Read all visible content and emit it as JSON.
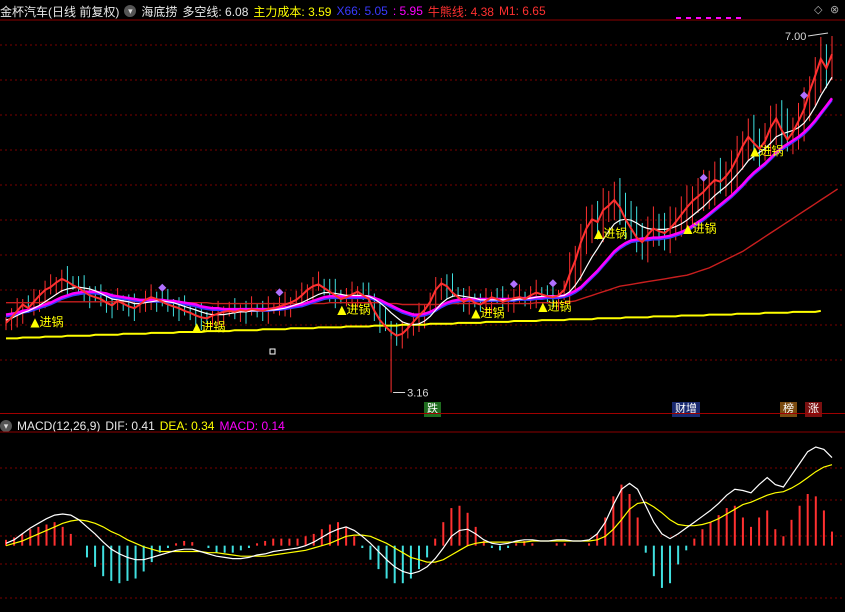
{
  "header": {
    "stock_name": "金杯汽车",
    "period_label": "(日线 前复权)",
    "indicator_name": "海底捞",
    "items": [
      {
        "label": "多空线:",
        "value": "6.08",
        "color": "#ffffff"
      },
      {
        "label": "主力成本:",
        "value": "3.59",
        "color": "#ffff00"
      },
      {
        "label": "X66:",
        "value": "5.05",
        "color": "#3a3aff"
      },
      {
        "label": ":",
        "value": "5.95",
        "color": "#ff00ff"
      },
      {
        "label": "牛熊线:",
        "value": "4.38",
        "color": "#ff3030"
      },
      {
        "label": "M1:",
        "value": "6.65",
        "color": "#ff3030"
      }
    ]
  },
  "macd_header": {
    "name": "MACD(12,26,9)",
    "dif_label": "DIF:",
    "dif_value": "0.41",
    "dea_label": "DEA:",
    "dea_value": "0.34",
    "macd_label": "MACD:",
    "macd_value": "0.14"
  },
  "window_buttons": {
    "up": "◇",
    "close": "⊗"
  },
  "badges": [
    {
      "text": "跌",
      "bg": "#1e6b1e",
      "color": "#ffffff"
    },
    {
      "text": "财增",
      "bg": "#1a2a70",
      "color": "#ffffff"
    },
    {
      "text": "榜",
      "bg": "#7a4a10",
      "color": "#ffffff"
    },
    {
      "text": "涨",
      "bg": "#7a1010",
      "color": "#ffffff"
    }
  ],
  "chart_data": {
    "type": "line",
    "annotations": {
      "high_label": "7.00",
      "low_label": "3.16",
      "signal_text": "▲进锅"
    },
    "colors": {
      "up": "#ff3030",
      "down": "#40e0e0",
      "multi_line": "#ffffff",
      "x66": "#3a3aff",
      "pink": "#ff00ff",
      "bull_bear": "#c81e1e",
      "cost": "#ffff00",
      "signal": "#ffff00",
      "diamond": "#b070ff",
      "dif": "#ffffff",
      "dea": "#ffff00"
    },
    "price_close": [
      3.92,
      3.98,
      4.05,
      4.12,
      4.08,
      4.15,
      4.22,
      4.28,
      4.31,
      4.36,
      4.4,
      4.37,
      4.33,
      4.3,
      4.26,
      4.22,
      4.2,
      4.18,
      4.14,
      4.11,
      4.16,
      4.13,
      4.1,
      4.08,
      4.12,
      4.17,
      4.2,
      4.18,
      4.15,
      4.12,
      4.1,
      4.08,
      4.05,
      4.03,
      4.0,
      3.98,
      3.97,
      4.0,
      4.02,
      4.04,
      4.05,
      4.04,
      4.06,
      4.05,
      4.07,
      4.06,
      4.05,
      4.07,
      4.08,
      4.1,
      4.12,
      4.14,
      4.17,
      4.22,
      4.28,
      4.32,
      4.34,
      4.3,
      4.26,
      4.22,
      4.18,
      4.2,
      4.23,
      4.26,
      4.22,
      4.18,
      4.05,
      3.95,
      3.88,
      3.82,
      3.78,
      3.8,
      3.86,
      3.93,
      4.0,
      4.06,
      4.15,
      4.28,
      4.35,
      4.32,
      4.25,
      4.2,
      4.15,
      4.18,
      4.14,
      4.12,
      4.16,
      4.2,
      4.18,
      4.15,
      4.17,
      4.19,
      4.2,
      4.18,
      4.22,
      4.25,
      4.23,
      4.21,
      4.2,
      4.22,
      4.28,
      4.45,
      4.6,
      4.8,
      4.95,
      5.05,
      5.02,
      5.15,
      5.2,
      5.26,
      5.18,
      5.05,
      4.95,
      4.85,
      4.8,
      4.88,
      4.95,
      4.92,
      4.9,
      4.95,
      5.02,
      5.1,
      5.18,
      5.25,
      5.3,
      5.35,
      5.42,
      5.48,
      5.46,
      5.52,
      5.6,
      5.72,
      5.85,
      5.95,
      5.88,
      5.82,
      5.9,
      6.05,
      6.15,
      6.02,
      5.92,
      6.0,
      6.12,
      6.25,
      6.45,
      6.62,
      6.8,
      6.7,
      6.85
    ],
    "multi_line": [
      3.95,
      3.97,
      4.0,
      4.03,
      4.05,
      4.08,
      4.11,
      4.15,
      4.19,
      4.23,
      4.27,
      4.29,
      4.3,
      4.31,
      4.3,
      4.29,
      4.27,
      4.24,
      4.21,
      4.18,
      4.17,
      4.16,
      4.15,
      4.13,
      4.13,
      4.14,
      4.15,
      4.16,
      4.16,
      4.15,
      4.14,
      4.12,
      4.1,
      4.08,
      4.06,
      4.04,
      4.02,
      4.01,
      4.01,
      4.01,
      4.02,
      4.03,
      4.04,
      4.04,
      4.05,
      4.05,
      4.05,
      4.06,
      4.06,
      4.07,
      4.08,
      4.1,
      4.12,
      4.14,
      4.17,
      4.2,
      4.23,
      4.25,
      4.25,
      4.24,
      4.23,
      4.22,
      4.22,
      4.22,
      4.22,
      4.21,
      4.18,
      4.14,
      4.09,
      4.03,
      3.98,
      3.93,
      3.91,
      3.9,
      3.91,
      3.94,
      3.99,
      4.06,
      4.13,
      4.18,
      4.21,
      4.22,
      4.21,
      4.2,
      4.19,
      4.17,
      4.17,
      4.17,
      4.17,
      4.17,
      4.17,
      4.17,
      4.18,
      4.18,
      4.19,
      4.2,
      4.21,
      4.21,
      4.21,
      4.21,
      4.22,
      4.26,
      4.33,
      4.42,
      4.53,
      4.64,
      4.73,
      4.83,
      4.92,
      5.0,
      5.04,
      5.05,
      5.04,
      5.01,
      4.97,
      4.95,
      4.94,
      4.94,
      4.94,
      4.95,
      4.97,
      5.0,
      5.04,
      5.09,
      5.14,
      5.19,
      5.25,
      5.31,
      5.36,
      5.41,
      5.47,
      5.54,
      5.61,
      5.69,
      5.74,
      5.78,
      5.82,
      5.88,
      5.95,
      5.98,
      6.0,
      6.02,
      6.05,
      6.1,
      6.18,
      6.28,
      6.4,
      6.5,
      6.6
    ],
    "x66": [
      3.99,
      4.0,
      4.01,
      4.03,
      4.04,
      4.06,
      4.08,
      4.1,
      4.12,
      4.15,
      4.18,
      4.2,
      4.22,
      4.23,
      4.24,
      4.24,
      4.24,
      4.23,
      4.22,
      4.2,
      4.19,
      4.18,
      4.17,
      4.16,
      4.15,
      4.15,
      4.15,
      4.15,
      4.15,
      4.14,
      4.14,
      4.13,
      4.12,
      4.11,
      4.1,
      4.08,
      4.07,
      4.06,
      4.06,
      4.05,
      4.05,
      4.05,
      4.05,
      4.05,
      4.05,
      4.05,
      4.05,
      4.05,
      4.06,
      4.06,
      4.07,
      4.08,
      4.09,
      4.1,
      4.12,
      4.14,
      4.16,
      4.18,
      4.19,
      4.19,
      4.19,
      4.19,
      4.19,
      4.19,
      4.19,
      4.19,
      4.17,
      4.15,
      4.12,
      4.09,
      4.06,
      4.03,
      4.01,
      3.99,
      3.99,
      4.0,
      4.02,
      4.05,
      4.09,
      4.12,
      4.14,
      4.15,
      4.16,
      4.16,
      4.16,
      4.16,
      4.16,
      4.16,
      4.16,
      4.16,
      4.16,
      4.16,
      4.17,
      4.17,
      4.17,
      4.18,
      4.18,
      4.19,
      4.19,
      4.19,
      4.2,
      4.22,
      4.25,
      4.29,
      4.35,
      4.41,
      4.47,
      4.54,
      4.61,
      4.68,
      4.73,
      4.77,
      4.8,
      4.81,
      4.82,
      4.82,
      4.83,
      4.83,
      4.84,
      4.85,
      4.87,
      4.89,
      4.92,
      4.96,
      5.0,
      5.04,
      5.09,
      5.14,
      5.19,
      5.24,
      5.29,
      5.35,
      5.41,
      5.48,
      5.54,
      5.59,
      5.64,
      5.7,
      5.76,
      5.81,
      5.85,
      5.89,
      5.93,
      5.98,
      6.04,
      6.11,
      6.19,
      6.27,
      6.35
    ],
    "bull_bear": [
      4.14,
      4.14,
      4.14,
      4.14,
      4.14,
      4.14,
      4.14,
      4.15,
      4.15,
      4.15,
      4.15,
      4.15,
      4.15,
      4.15,
      4.15,
      4.15,
      4.15,
      4.15,
      4.15,
      4.15,
      4.15,
      4.15,
      4.15,
      4.15,
      4.15,
      4.15,
      4.15,
      4.15,
      4.15,
      4.15,
      4.14,
      4.14,
      4.14,
      4.14,
      4.14,
      4.14,
      4.14,
      4.13,
      4.13,
      4.13,
      4.13,
      4.13,
      4.13,
      4.13,
      4.13,
      4.13,
      4.13,
      4.13,
      4.13,
      4.13,
      4.13,
      4.13,
      4.13,
      4.13,
      4.13,
      4.13,
      4.13,
      4.13,
      4.14,
      4.14,
      4.14,
      4.14,
      4.14,
      4.14,
      4.14,
      4.14,
      4.14,
      4.14,
      4.13,
      4.13,
      4.13,
      4.12,
      4.12,
      4.12,
      4.12,
      4.12,
      4.12,
      4.12,
      4.12,
      4.12,
      4.13,
      4.13,
      4.13,
      4.13,
      4.13,
      4.13,
      4.13,
      4.13,
      4.13,
      4.13,
      4.13,
      4.13,
      4.13,
      4.13,
      4.13,
      4.14,
      4.14,
      4.14,
      4.14,
      4.14,
      4.14,
      4.15,
      4.16,
      4.18,
      4.2,
      4.22,
      4.24,
      4.26,
      4.28,
      4.3,
      4.32,
      4.33,
      4.34,
      4.35,
      4.36,
      4.37,
      4.38,
      4.39,
      4.4,
      4.41,
      4.42,
      4.43,
      4.44,
      4.46,
      4.48,
      4.5,
      4.52,
      4.55,
      4.58,
      4.61,
      4.64,
      4.67,
      4.7,
      4.74,
      4.78,
      4.82,
      4.86,
      4.9,
      4.94,
      4.98,
      5.02,
      5.06,
      5.1,
      5.14,
      5.18,
      5.22,
      5.26,
      5.3,
      5.34,
      5.38
    ],
    "cost_line": [
      3.75,
      3.75,
      3.75,
      3.76,
      3.76,
      3.76,
      3.76,
      3.77,
      3.77,
      3.77,
      3.77,
      3.78,
      3.78,
      3.78,
      3.78,
      3.78,
      3.79,
      3.79,
      3.79,
      3.79,
      3.79,
      3.8,
      3.8,
      3.8,
      3.8,
      3.8,
      3.81,
      3.81,
      3.81,
      3.81,
      3.81,
      3.82,
      3.82,
      3.82,
      3.82,
      3.82,
      3.83,
      3.83,
      3.83,
      3.83,
      3.83,
      3.84,
      3.84,
      3.84,
      3.84,
      3.84,
      3.85,
      3.85,
      3.85,
      3.85,
      3.85,
      3.86,
      3.86,
      3.86,
      3.86,
      3.86,
      3.87,
      3.87,
      3.87,
      3.87,
      3.87,
      3.88,
      3.88,
      3.88,
      3.88,
      3.88,
      3.89,
      3.89,
      3.89,
      3.89,
      3.89,
      3.9,
      3.9,
      3.9,
      3.9,
      3.9,
      3.91,
      3.91,
      3.91,
      3.91,
      3.91,
      3.92,
      3.92,
      3.92,
      3.92,
      3.92,
      3.93,
      3.93,
      3.93,
      3.93,
      3.93,
      3.94,
      3.94,
      3.94,
      3.94,
      3.94,
      3.95,
      3.95,
      3.95,
      3.95,
      3.95,
      3.96,
      3.96,
      3.96,
      3.96,
      3.96,
      3.97,
      3.97,
      3.97,
      3.97,
      3.97,
      3.98,
      3.98,
      3.98,
      3.98,
      3.98,
      3.99,
      3.99,
      3.99,
      3.99,
      3.99,
      4.0,
      4.0,
      4.0,
      4.0,
      4.0,
      4.01,
      4.01,
      4.01,
      4.01,
      4.01,
      4.02,
      4.02,
      4.02,
      4.02,
      4.02,
      4.03,
      4.03,
      4.03,
      4.03,
      4.03,
      4.04,
      4.04,
      4.04,
      4.04,
      4.04,
      4.05
    ],
    "signals": [
      4,
      33,
      59,
      83,
      95,
      105,
      121,
      133
    ],
    "diamonds": [
      28,
      49,
      91,
      98,
      125,
      143
    ],
    "price_range": [
      3.1,
      7.05
    ],
    "macd_dif": [
      0.02,
      0.05,
      0.1,
      0.15,
      0.19,
      0.23,
      0.26,
      0.27,
      0.26,
      0.22,
      0.16,
      0.1,
      0.03,
      -0.03,
      -0.07,
      -0.1,
      -0.12,
      -0.12,
      -0.1,
      -0.08,
      -0.06,
      -0.04,
      -0.03,
      -0.03,
      -0.05,
      -0.07,
      -0.09,
      -0.1,
      -0.11,
      -0.11,
      -0.1,
      -0.08,
      -0.07,
      -0.05,
      -0.04,
      -0.03,
      -0.02,
      0.0,
      0.03,
      0.07,
      0.11,
      0.14,
      0.16,
      0.13,
      0.08,
      0.02,
      -0.05,
      -0.12,
      -0.18,
      -0.22,
      -0.24,
      -0.22,
      -0.18,
      -0.11,
      -0.02,
      0.08,
      0.13,
      0.14,
      0.1,
      0.05,
      0.02,
      0.01,
      0.02,
      0.04,
      0.05,
      0.05,
      0.04,
      0.04,
      0.05,
      0.05,
      0.04,
      0.04,
      0.05,
      0.1,
      0.2,
      0.35,
      0.48,
      0.53,
      0.48,
      0.34,
      0.2,
      0.1,
      0.06,
      0.1,
      0.15,
      0.2,
      0.25,
      0.3,
      0.36,
      0.43,
      0.48,
      0.47,
      0.45,
      0.52,
      0.58,
      0.52,
      0.5,
      0.6,
      0.7,
      0.8,
      0.84,
      0.82,
      0.75
    ],
    "macd_dea": [
      0.0,
      0.02,
      0.04,
      0.07,
      0.1,
      0.13,
      0.16,
      0.19,
      0.21,
      0.22,
      0.21,
      0.19,
      0.16,
      0.12,
      0.09,
      0.05,
      0.02,
      -0.01,
      -0.03,
      -0.05,
      -0.05,
      -0.05,
      -0.05,
      -0.05,
      -0.05,
      -0.06,
      -0.06,
      -0.07,
      -0.08,
      -0.09,
      -0.09,
      -0.09,
      -0.09,
      -0.08,
      -0.07,
      -0.06,
      -0.05,
      -0.04,
      -0.02,
      0.0,
      0.02,
      0.05,
      0.08,
      0.09,
      0.09,
      0.08,
      0.05,
      0.02,
      -0.02,
      -0.06,
      -0.1,
      -0.12,
      -0.14,
      -0.14,
      -0.12,
      -0.08,
      -0.04,
      0.0,
      0.02,
      0.03,
      0.03,
      0.03,
      0.03,
      0.03,
      0.03,
      0.04,
      0.04,
      0.04,
      0.04,
      0.04,
      0.04,
      0.04,
      0.04,
      0.05,
      0.08,
      0.14,
      0.22,
      0.31,
      0.36,
      0.37,
      0.33,
      0.28,
      0.22,
      0.18,
      0.17,
      0.17,
      0.18,
      0.2,
      0.23,
      0.27,
      0.31,
      0.35,
      0.37,
      0.4,
      0.43,
      0.45,
      0.46,
      0.49,
      0.53,
      0.58,
      0.63,
      0.67,
      0.69
    ],
    "macd_hist": [
      0.05,
      0.07,
      0.1,
      0.14,
      0.16,
      0.18,
      0.2,
      0.16,
      0.1,
      0.0,
      -0.1,
      -0.18,
      -0.26,
      -0.3,
      -0.32,
      -0.3,
      -0.28,
      -0.22,
      -0.14,
      -0.06,
      -0.02,
      0.02,
      0.04,
      0.03,
      0.0,
      -0.02,
      -0.06,
      -0.06,
      -0.06,
      -0.04,
      -0.02,
      0.02,
      0.04,
      0.06,
      0.06,
      0.06,
      0.06,
      0.08,
      0.1,
      0.14,
      0.18,
      0.2,
      0.16,
      0.08,
      -0.02,
      -0.12,
      -0.2,
      -0.28,
      -0.32,
      -0.32,
      -0.28,
      -0.2,
      -0.1,
      0.06,
      0.2,
      0.32,
      0.34,
      0.28,
      0.16,
      0.04,
      -0.02,
      -0.04,
      -0.02,
      0.02,
      0.04,
      0.02,
      0.0,
      0.0,
      0.02,
      0.02,
      0.0,
      0.0,
      0.02,
      0.1,
      0.24,
      0.42,
      0.52,
      0.44,
      0.24,
      -0.06,
      -0.26,
      -0.36,
      -0.32,
      -0.16,
      -0.04,
      0.06,
      0.14,
      0.2,
      0.26,
      0.32,
      0.34,
      0.24,
      0.16,
      0.24,
      0.3,
      0.14,
      0.08,
      0.22,
      0.34,
      0.44,
      0.42,
      0.3,
      0.12
    ],
    "macd_range": [
      -0.48,
      0.9
    ]
  }
}
